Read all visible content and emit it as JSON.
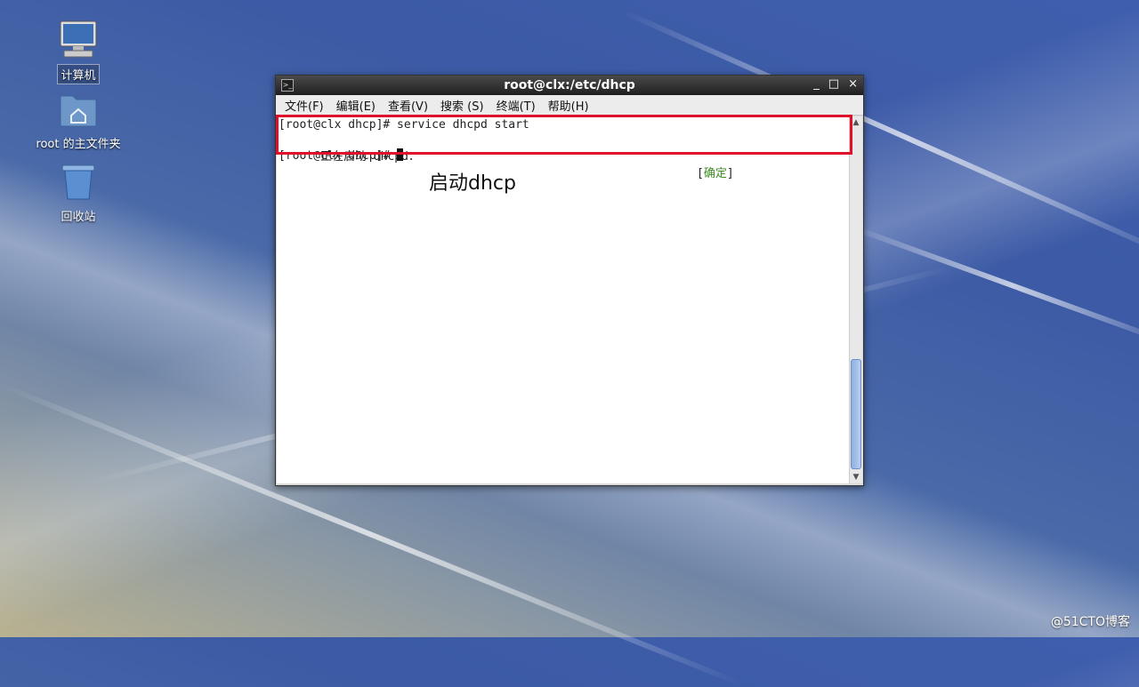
{
  "desktop": {
    "icons": [
      {
        "label": "计算机",
        "icon": "computer-icon"
      },
      {
        "label": "root 的主文件夹",
        "icon": "home-folder-icon"
      },
      {
        "label": "回收站",
        "icon": "trash-icon"
      }
    ]
  },
  "window": {
    "title": "root@clx:/etc/dhcp",
    "controls": {
      "minimize": "_",
      "maximize": "□",
      "close": "×"
    },
    "menu": [
      "文件(F)",
      "编辑(E)",
      "查看(V)",
      "搜索 (S)",
      "终端(T)",
      "帮助(H)"
    ]
  },
  "terminal": {
    "line1": "[root@clx dhcp]# service dhcpd start",
    "line2_prefix": "正在启动 dhcpd：",
    "line2_status_open": "[",
    "line2_status": "确定",
    "line2_status_close": "]",
    "line3": "[root@clx dhcp]# "
  },
  "annotation": "启动dhcp",
  "watermark": "@51CTO博客",
  "colors": {
    "highlight_box": "#e0102a",
    "ok_text": "#3a8a20"
  }
}
